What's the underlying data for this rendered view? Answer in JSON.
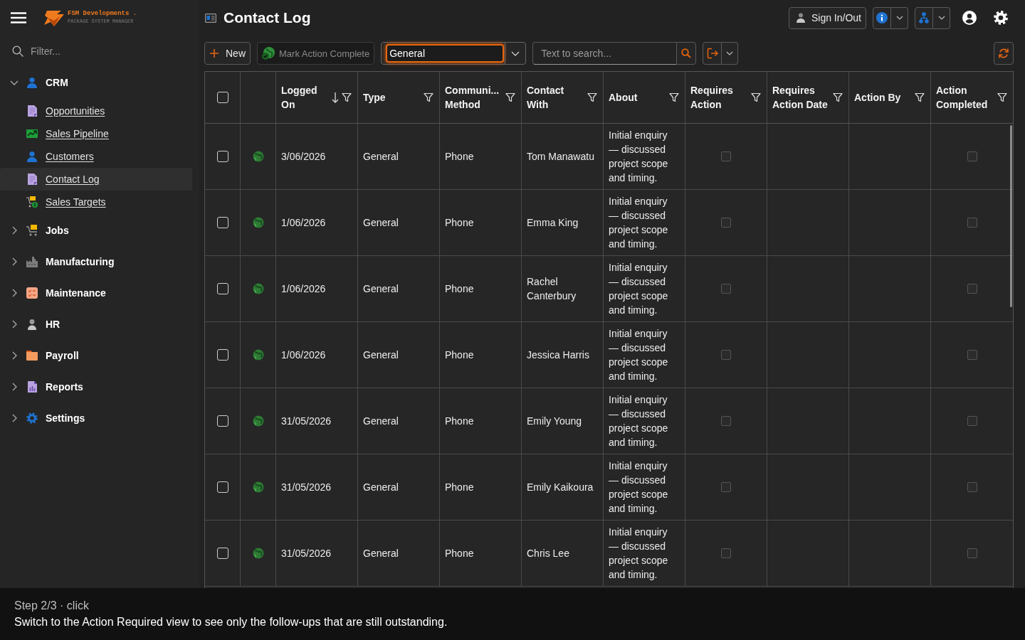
{
  "header": {
    "brand": "FSM Developments .",
    "tagline": "PACKAGE SYSTEM MANAGER",
    "title": "Contact Log",
    "sign_in_button": "Sign In/Out"
  },
  "sidebar": {
    "filter_placeholder": "Filter...",
    "items": [
      {
        "label": "CRM",
        "expanded": true,
        "children": [
          {
            "label": "Opportunities",
            "selected": false
          },
          {
            "label": "Sales Pipeline",
            "selected": false
          },
          {
            "label": "Customers",
            "selected": false
          },
          {
            "label": "Contact Log",
            "selected": true
          },
          {
            "label": "Sales Targets",
            "selected": false
          }
        ]
      },
      {
        "label": "Jobs",
        "expanded": false
      },
      {
        "label": "Manufacturing",
        "expanded": false
      },
      {
        "label": "Maintenance",
        "expanded": false
      },
      {
        "label": "HR",
        "expanded": false
      },
      {
        "label": "Payroll",
        "expanded": false
      },
      {
        "label": "Reports",
        "expanded": false
      },
      {
        "label": "Settings",
        "expanded": false
      }
    ]
  },
  "toolbar": {
    "new_button": "New",
    "complete_button": {
      "label": "Mark Action Complete",
      "disabled": true
    },
    "view_select": {
      "value": "General",
      "focused": true
    },
    "search": {
      "placeholder": "Text to search..."
    }
  },
  "table": {
    "select_all": {
      "checked": false
    },
    "columns": [
      {
        "label": "Logged On",
        "sorted_descending": true
      },
      {
        "label": "Type"
      },
      {
        "label": "Communi... Method"
      },
      {
        "label": "Contact With"
      },
      {
        "label": "About"
      },
      {
        "label": "Requires Action"
      },
      {
        "label": "Requires Action Date"
      },
      {
        "label": "Action By"
      },
      {
        "label": "Action Completed"
      }
    ],
    "rows": [
      {
        "selected": false,
        "logged_on": "3/06/2026",
        "type": "General",
        "method": "Phone",
        "contact_with": "Tom Manawatu",
        "about": "Initial enquiry — discussed project scope and timing.",
        "requires_action": false,
        "action_completed": false
      },
      {
        "selected": false,
        "logged_on": "1/06/2026",
        "type": "General",
        "method": "Phone",
        "contact_with": "Emma King",
        "about": "Initial enquiry — discussed project scope and timing.",
        "requires_action": false,
        "action_completed": false
      },
      {
        "selected": false,
        "logged_on": "1/06/2026",
        "type": "General",
        "method": "Phone",
        "contact_with": "Rachel Canterbury",
        "about": "Initial enquiry — discussed project scope and timing.",
        "requires_action": false,
        "action_completed": false
      },
      {
        "selected": false,
        "logged_on": "1/06/2026",
        "type": "General",
        "method": "Phone",
        "contact_with": "Jessica Harris",
        "about": "Initial enquiry — discussed project scope and timing.",
        "requires_action": false,
        "action_completed": false
      },
      {
        "selected": false,
        "logged_on": "31/05/2026",
        "type": "General",
        "method": "Phone",
        "contact_with": "Emily Young",
        "about": "Initial enquiry — discussed project scope and timing.",
        "requires_action": false,
        "action_completed": false
      },
      {
        "selected": false,
        "logged_on": "31/05/2026",
        "type": "General",
        "method": "Phone",
        "contact_with": "Emily Kaikoura",
        "about": "Initial enquiry — discussed project scope and timing.",
        "requires_action": false,
        "action_completed": false
      },
      {
        "selected": false,
        "logged_on": "31/05/2026",
        "type": "General",
        "method": "Phone",
        "contact_with": "Chris Lee",
        "about": "Initial enquiry — discussed project scope and timing.",
        "requires_action": false,
        "action_completed": false
      }
    ]
  },
  "tutorial": {
    "step": "Step 2/3 · click",
    "message": "Switch to the Action Required view to see only the follow-ups that are still outstanding."
  }
}
